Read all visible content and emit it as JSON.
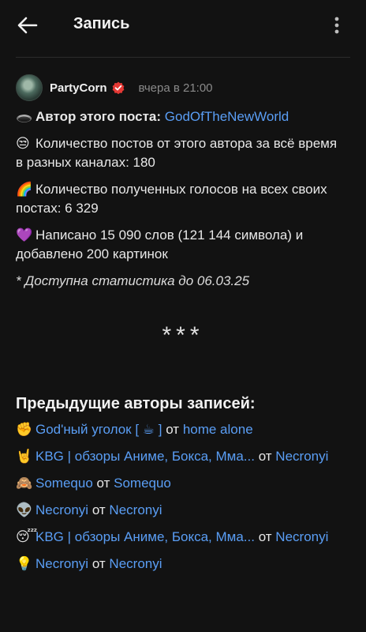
{
  "header": {
    "title": "Запись",
    "back_icon": "arrow-left-icon",
    "menu_icon": "more-vertical-icon"
  },
  "post": {
    "author": "PartyCorn",
    "verified_color": "#e53935",
    "time": "вчера в 21:00",
    "lines": {
      "author_label": "Автор этого поста:",
      "author_link": "GodOfTheNewWorld",
      "posts_count_text": "Количество постов от этого автора за всё время в разных каналах: 180",
      "votes_text": "Количество полученных голосов на всех своих постах: 6 329",
      "words_text": "Написано 15 090 слов (121 144 символа) и добавлено 200 картинок",
      "stats_note": "* Доступна статистика до 06.03.25"
    },
    "emojis": {
      "author": "🕳️",
      "posts": "😒",
      "votes": "🌈",
      "words": "💜"
    },
    "separator": "***"
  },
  "previous": {
    "title": "Предыдущие авторы записей:",
    "from_word": "от",
    "items": [
      {
        "emoji": "✊",
        "channel": "God'ный уголок [ ☕ ]",
        "author": "home alone"
      },
      {
        "emoji": "🤘",
        "channel": "KBG | обзоры Аниме, Бокса, Мма...",
        "author": "Necronyi"
      },
      {
        "emoji": "🙈",
        "channel": "Somequo",
        "author": "Somequo"
      },
      {
        "emoji": "👽",
        "channel": "Necronyi",
        "author": "Necronyi"
      },
      {
        "emoji": "😴",
        "channel": "KBG | обзоры Аниме, Бокса, Мма...",
        "author": "Necronyi"
      },
      {
        "emoji": "💡",
        "channel": "Necronyi",
        "author": "Necronyi"
      }
    ]
  },
  "colors": {
    "background": "#121212",
    "link": "#5a9ef5",
    "muted": "#8a8a8a"
  }
}
